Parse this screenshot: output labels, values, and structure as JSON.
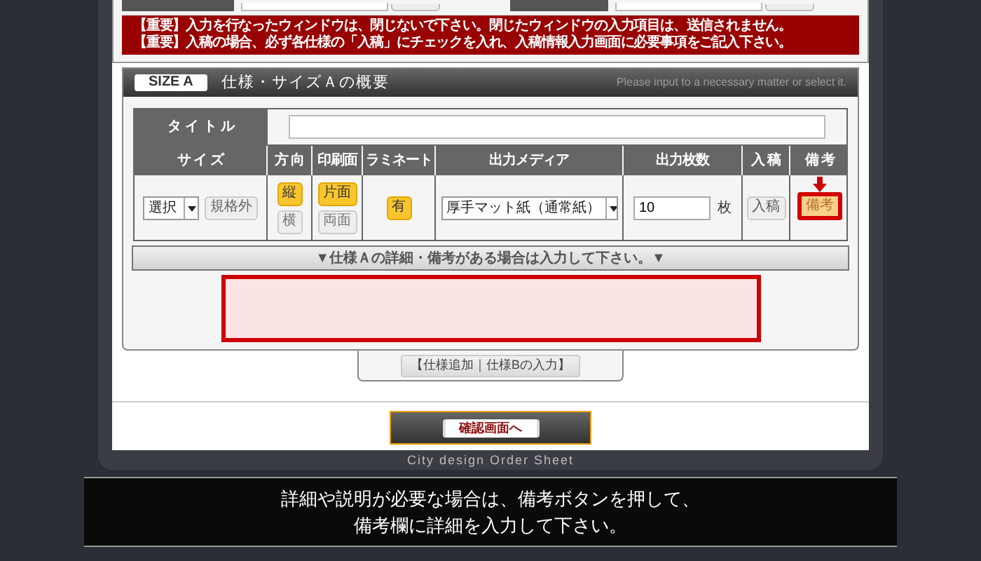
{
  "notices": [
    "【重要】入力を行なったウィンドウは、閉じないで下さい。閉じたウィンドウの入力項目は、送信されません。",
    "【重要】入稿の場合、必ず各仕様の「入稿」にチェックを入れ、入稿情報入力画面に必要事項をご記入下さい。"
  ],
  "section": {
    "badge": "SIZE A",
    "title": "仕様・サイズＡの概要",
    "hint": "Please input to a necessary matter or select it."
  },
  "table": {
    "title_label": "タ イ ト ル",
    "columns": [
      "サ イ ズ",
      "方 向",
      "印刷面",
      "ラミネート",
      "出力メディア",
      "出力枚数",
      "入 稿",
      "備 考"
    ],
    "size_select": "選択",
    "size_button": "規格外",
    "orientation": [
      {
        "label": "縦",
        "selected": true
      },
      {
        "label": "横",
        "selected": false
      }
    ],
    "sides": [
      {
        "label": "片面",
        "selected": true
      },
      {
        "label": "両面",
        "selected": false
      }
    ],
    "laminate": [
      {
        "label": "有",
        "selected": true
      }
    ],
    "media_select": "厚手マット紙（通常紙）",
    "count": "10",
    "count_unit": "枚",
    "submit_button": "入稿",
    "note_button": {
      "label": "備考",
      "highlighted": true
    }
  },
  "details_bar": "▼仕様Ａの詳細・備考がある場合は入力して下さい。▼",
  "notes_field": {
    "highlighted": true
  },
  "add_spec_button": "【仕様追加｜仕様Bの入力】",
  "confirm_button": "確認画面へ",
  "footer": "City design Order Sheet",
  "caption": [
    "詳細や説明が必要な場合は、備考ボタンを押して、",
    "備考欄に詳細を入力して下さい。"
  ]
}
